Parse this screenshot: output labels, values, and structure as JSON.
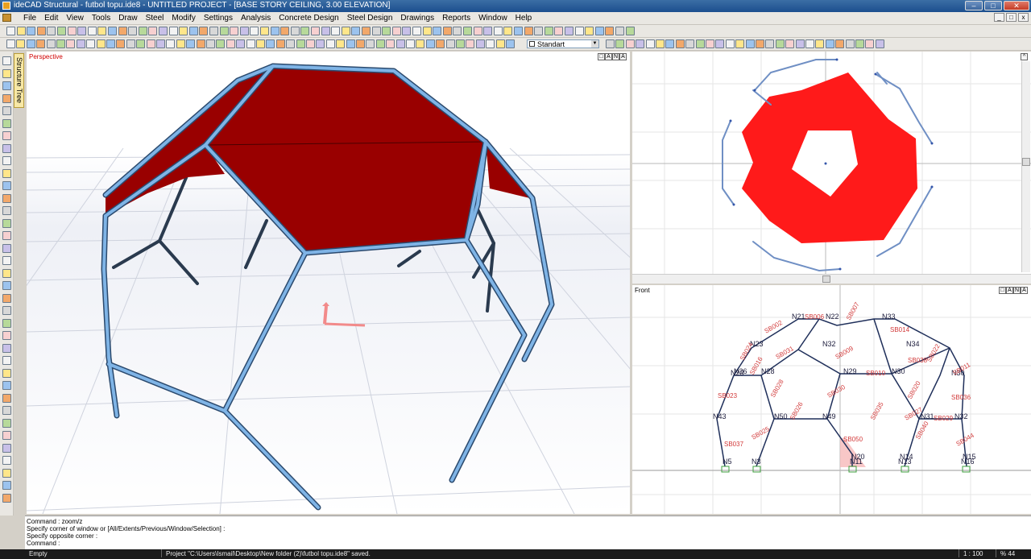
{
  "window": {
    "title": "ideCAD Structural - futbol topu.ide8 - UNTITLED PROJECT - [BASE STORY CEILING,  3.00 ELEVATION]"
  },
  "menu": [
    "File",
    "Edit",
    "View",
    "Tools",
    "Draw",
    "Steel",
    "Modify",
    "Settings",
    "Analysis",
    "Concrete Design",
    "Steel Design",
    "Drawings",
    "Reports",
    "Window",
    "Help"
  ],
  "toolbar": {
    "style_combo": "Standart"
  },
  "sidebar": {
    "tab_label": "Structure Tree"
  },
  "viewports": {
    "perspective": {
      "label": "Perspective"
    },
    "plan": {
      "label": ""
    },
    "front": {
      "label": "Front"
    },
    "buttons": [
      "□",
      "A",
      "N",
      "A"
    ]
  },
  "front_labels": {
    "nodes": [
      "N21",
      "N22",
      "N23",
      "N23",
      "N32",
      "N33",
      "N34",
      "N26",
      "N28",
      "N29",
      "N30",
      "N30",
      "N43",
      "N50",
      "N49",
      "N31",
      "N32",
      "N5",
      "N3",
      "N11",
      "N20",
      "N13",
      "N14",
      "N16",
      "N15"
    ],
    "beams": [
      "SB006",
      "SB007",
      "SB002",
      "SB014",
      "SB024",
      "SB031",
      "SB038",
      "SB022",
      "SB009",
      "SB010",
      "SB016",
      "SB011",
      "SB023",
      "SB028",
      "SB030",
      "SB036",
      "SB026",
      "SB027",
      "SB029",
      "SB020",
      "SB025",
      "SB037",
      "SB040",
      "SB044",
      "SB050",
      "SB035"
    ]
  },
  "command": {
    "lines": [
      "Command : zoom/z",
      "Specify corner of window or [All/Extents/Previous/Window/Selection] :",
      "Specify opposite corner :",
      "Command :"
    ]
  },
  "status": {
    "left": "Empty",
    "message": "Project \"C:\\Users\\Ismail\\Desktop\\New folder (2)\\futbol topu.ide8\" saved.",
    "scale": "1 : 100",
    "zoom": "% 44"
  },
  "colors": {
    "slab_3d": "#990000",
    "slab_plan": "#ff1a1a",
    "steel": "#6fa6dc",
    "label_red": "#d23a3a"
  },
  "icons": [
    "app-icon",
    "new-icon",
    "open-icon",
    "save-icon",
    "undo-icon",
    "redo-icon",
    "zoom-icon",
    "pan-icon",
    "rotate-icon",
    "line-icon",
    "grid-icon",
    "column-icon",
    "beam-icon",
    "slab-icon",
    "wall-icon",
    "axis-icon"
  ]
}
